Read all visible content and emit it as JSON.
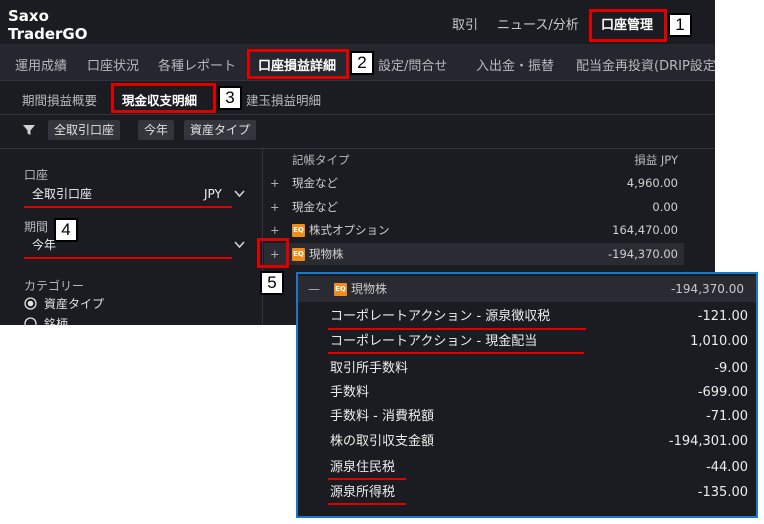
{
  "app": {
    "name_line1": "Saxo",
    "name_line2": "TraderGO"
  },
  "top_nav": [
    "取引",
    "ニュース/分析",
    "口座管理"
  ],
  "sub_nav": [
    "運用成績",
    "口座状況",
    "各種レポート",
    "口座損益詳細",
    "設定/問合せ",
    "入出金・振替",
    "配当金再投資(DRIP設定"
  ],
  "report_tabs": [
    "期間損益概要",
    "現金収支明細",
    "建玉損益明細"
  ],
  "filter_chips": [
    "全取引口座",
    "今年",
    "資産タイプ"
  ],
  "sidebar": {
    "account_label": "口座",
    "account_value": "全取引口座",
    "currency": "JPY",
    "period_label": "期間",
    "period_value": "今年",
    "category_label": "カテゴリー",
    "radio_asset_type": "資産タイプ",
    "radio_symbol": "銘柄"
  },
  "table": {
    "col_type": "記帳タイプ",
    "col_pl": "損益 JPY",
    "rows": [
      {
        "name": "現金など",
        "value": "4,960.00"
      },
      {
        "name": "現金など",
        "value": "0.00"
      },
      {
        "name": "株式オプション",
        "value": "164,470.00",
        "icon": "EQ"
      },
      {
        "name": "現物株",
        "value": "-194,370.00",
        "icon": "EQ"
      }
    ]
  },
  "detail_popup": {
    "header_name": "現物株",
    "header_icon": "EQ",
    "header_value": "-194,370.00",
    "rows": [
      {
        "name": "コーポレートアクション - 源泉徴収税",
        "value": "-121.00"
      },
      {
        "name": "コーポレートアクション - 現金配当",
        "value": "1,010.00"
      },
      {
        "name": "取引所手数料",
        "value": "-9.00"
      },
      {
        "name": "手数料",
        "value": "-699.00"
      },
      {
        "name": "手数料 - 消費税額",
        "value": "-71.00"
      },
      {
        "name": "株の取引収支金額",
        "value": "-194,301.00"
      },
      {
        "name": "源泉住民税",
        "value": "-44.00"
      },
      {
        "name": "源泉所得税",
        "value": "-135.00"
      }
    ]
  },
  "callouts": [
    "1",
    "2",
    "3",
    "4",
    "5"
  ],
  "colors": {
    "highlight": "#e00000",
    "popup_border": "#1a78c8",
    "eq_badge": "#f08c1c",
    "app_bg": "#1b1c21"
  },
  "icons": {
    "filter": "filter-icon",
    "dropdown": "chevron-down-icon",
    "expand": "plus-icon",
    "collapse": "minus-icon",
    "radio": "radio-icon"
  }
}
